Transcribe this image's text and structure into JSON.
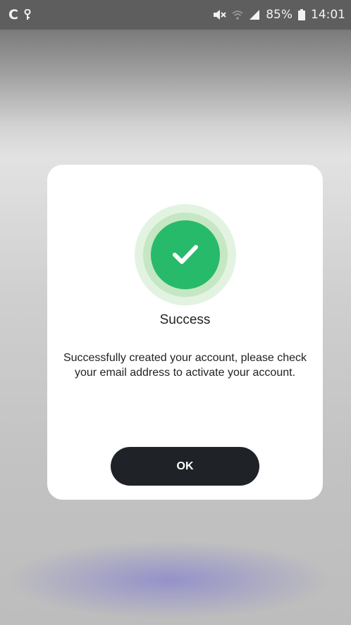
{
  "status_bar": {
    "left_icons": [
      "c-icon",
      "key-icon"
    ],
    "right_icons": [
      "silent-icon",
      "wifi-icon",
      "signal-icon",
      "battery-icon"
    ],
    "battery": "85%",
    "time": "14:01"
  },
  "dialog": {
    "icon": "check-icon",
    "accent_color": "#27ba6b",
    "title": "Success",
    "message": "Successfully created your account, please check your email address to activate your account.",
    "ok_label": "OK"
  }
}
